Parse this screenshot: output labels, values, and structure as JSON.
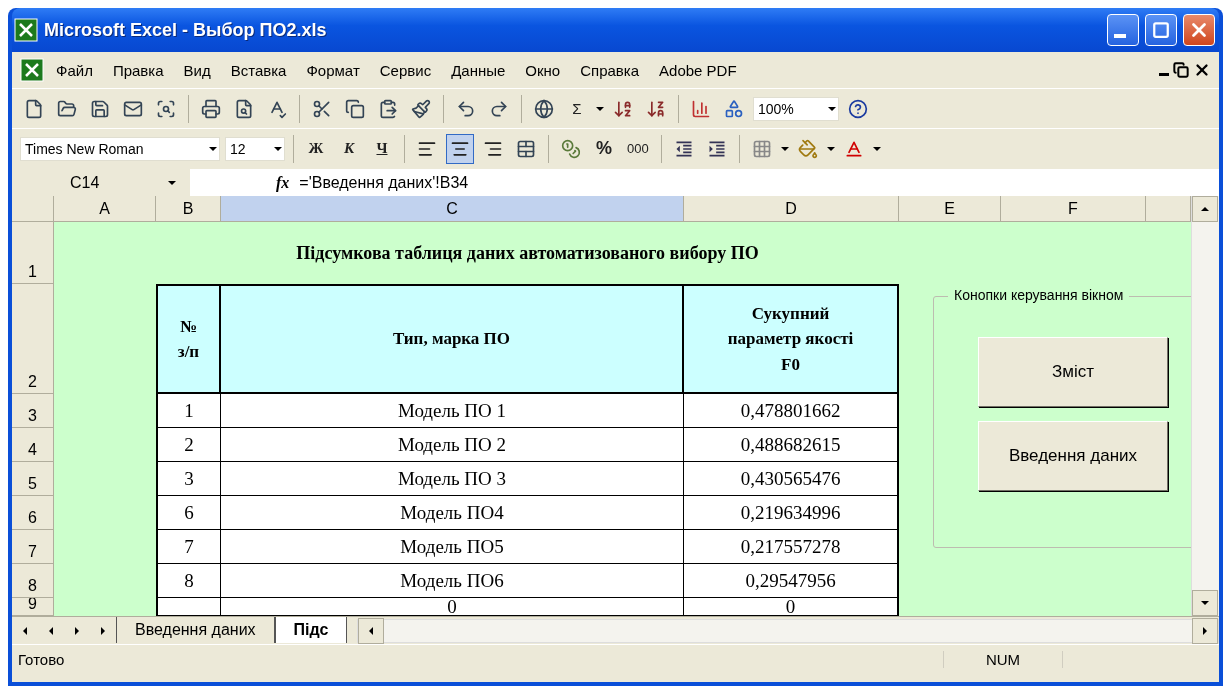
{
  "window": {
    "title": "Microsoft Excel - Выбор ПО2.xls"
  },
  "menu": [
    "Файл",
    "Правка",
    "Вид",
    "Вставка",
    "Формат",
    "Сервис",
    "Данные",
    "Окно",
    "Справка",
    "Adobe PDF"
  ],
  "standard_toolbar": {
    "sum": "Σ",
    "zoom": "100%"
  },
  "format_toolbar": {
    "font": "Times New Roman",
    "size": "12",
    "bold": "Ж",
    "italic": "К",
    "underline": "Ч",
    "percent": "%",
    "thousands": "000",
    "alignment": [
      {
        "selected": false
      },
      {
        "selected": true
      },
      {
        "selected": false
      }
    ]
  },
  "formula_bar": {
    "name_box": "C14",
    "fx": "fx",
    "formula": "='Введення даних'!B34"
  },
  "columns": [
    {
      "label": "A",
      "selected": false
    },
    {
      "label": "B",
      "selected": false
    },
    {
      "label": "C",
      "selected": true
    },
    {
      "label": "D",
      "selected": false
    },
    {
      "label": "E",
      "selected": false
    },
    {
      "label": "F",
      "selected": false
    }
  ],
  "row_headers": [
    "1",
    "2",
    "3",
    "4",
    "5",
    "6",
    "7",
    "8",
    "9"
  ],
  "sheet": {
    "title": "Підсумкова таблиця даних автоматизованого вибору ПО",
    "table_headers": [
      [
        "№",
        "з/п"
      ],
      [
        "Тип, марка ПО"
      ],
      [
        "Сукупний",
        "параметр якості",
        "F0"
      ]
    ],
    "rows": [
      [
        "1",
        "Модель ПО 1",
        "0,478801662"
      ],
      [
        "2",
        "Модель ПО 2",
        "0,488682615"
      ],
      [
        "3",
        "Модель ПО 3",
        "0,430565476"
      ],
      [
        "6",
        "Модель ПО4",
        "0,219634996"
      ],
      [
        "7",
        "Модель ПО5",
        "0,217557278"
      ],
      [
        "8",
        "Модель ПО6",
        "0,29547956"
      ],
      [
        "",
        "0",
        "0"
      ]
    ]
  },
  "control_group": {
    "title": "Конопки керування вікном",
    "buttons": [
      "Зміст",
      "Введення даних"
    ]
  },
  "sheet_tabs": [
    {
      "label": "Введення даних",
      "selected": false
    },
    {
      "label": "Підс",
      "selected": true
    }
  ],
  "status_bar": {
    "status": "Готово",
    "num": "NUM"
  }
}
